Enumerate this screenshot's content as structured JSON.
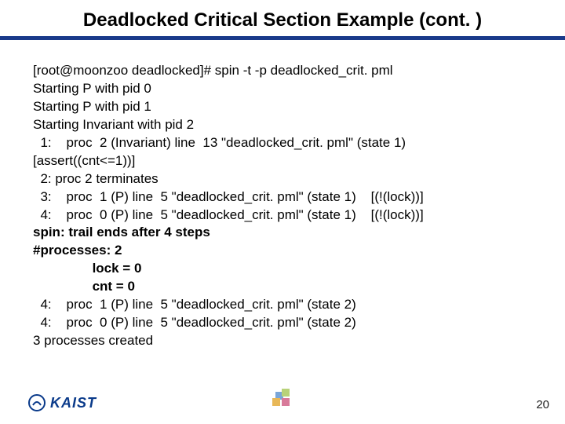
{
  "title": "Deadlocked Critical Section Example (cont. )",
  "lines": [
    "[root@moonzoo deadlocked]# spin -t -p deadlocked_crit. pml",
    "Starting P with pid 0",
    "Starting P with pid 1",
    "Starting Invariant with pid 2",
    "  1:    proc  2 (Invariant) line  13 \"deadlocked_crit. pml\" (state 1)",
    "[assert((cnt<=1))]",
    "  2: proc 2 terminates",
    "  3:    proc  1 (P) line  5 \"deadlocked_crit. pml\" (state 1)    [(!(lock))]",
    "  4:    proc  0 (P) line  5 \"deadlocked_crit. pml\" (state 1)    [(!(lock))]"
  ],
  "bold_lines": [
    "spin: trail ends after 4 steps",
    "#processes: 2",
    "                lock = 0",
    "                cnt = 0"
  ],
  "lines2": [
    "  4:    proc  1 (P) line  5 \"deadlocked_crit. pml\" (state 2)",
    "  4:    proc  0 (P) line  5 \"deadlocked_crit. pml\" (state 2)",
    "3 processes created"
  ],
  "logo_text": "KAIST",
  "page_number": "20"
}
